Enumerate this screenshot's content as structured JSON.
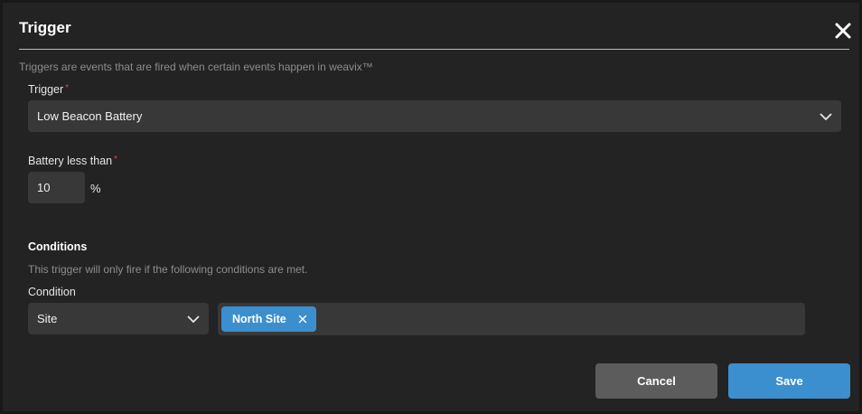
{
  "dialog": {
    "title": "Trigger",
    "subtitle": "Triggers are events that are fired when certain events happen in weavix™"
  },
  "trigger_field": {
    "label": "Trigger",
    "required_mark": "*",
    "value": "Low Beacon Battery"
  },
  "battery_field": {
    "label": "Battery less than",
    "required_mark": "*",
    "value": "10",
    "unit": "%"
  },
  "conditions": {
    "title": "Conditions",
    "description": "This trigger will only fire if the following conditions are met.",
    "condition_label": "Condition",
    "condition_type": "Site",
    "tags": [
      "North Site"
    ]
  },
  "buttons": {
    "cancel": "Cancel",
    "save": "Save"
  },
  "colors": {
    "accent": "#3b8fce",
    "required": "#e2424b",
    "background": "#232323",
    "field": "#383838"
  }
}
